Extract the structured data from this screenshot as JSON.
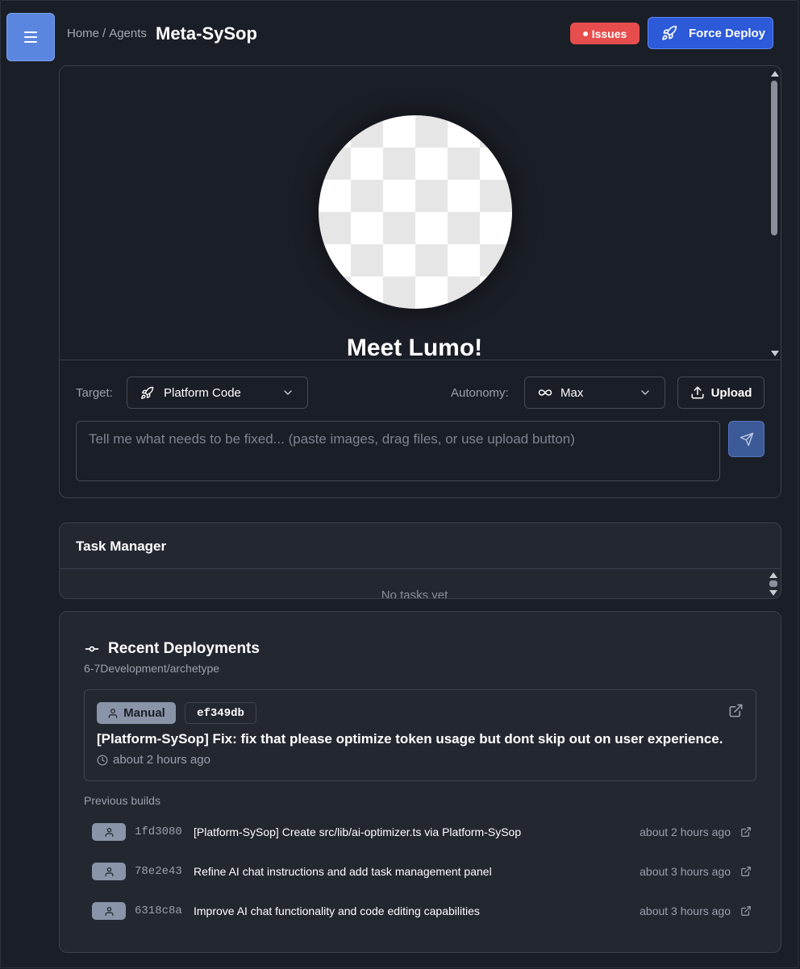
{
  "header": {
    "breadcrumb": [
      "Home",
      "/",
      "Agents"
    ],
    "title": "Meta-SySop",
    "issues_label": "Issues",
    "deploy_label": "Force Deploy"
  },
  "chat": {
    "welcome_title": "Meet Lumo!",
    "target_label": "Target:",
    "target_value": "Platform Code",
    "autonomy_label": "Autonomy:",
    "autonomy_value": "Max",
    "upload_label": "Upload",
    "input_placeholder": "Tell me what needs to be fixed... (paste images, drag files, or use upload button)",
    "input_value": ""
  },
  "tasks": {
    "title": "Task Manager",
    "empty_text": "No tasks yet"
  },
  "deployments": {
    "title": "Recent Deployments",
    "repo": "6-7Development/archetype",
    "latest": {
      "type": "Manual",
      "hash": "ef349db",
      "message": "[Platform-SySop] Fix: fix that please optimize token usage but dont skip out on user experience.",
      "time": "about 2 hours ago"
    },
    "previous_label": "Previous builds",
    "previous": [
      {
        "hash": "1fd3080",
        "message": "[Platform-SySop] Create src/lib/ai-optimizer.ts via Platform-SySop",
        "time": "about 2 hours ago"
      },
      {
        "hash": "78e2e43",
        "message": "Refine AI chat instructions and add task management panel",
        "time": "about 3 hours ago"
      },
      {
        "hash": "6318c8a",
        "message": "Improve AI chat functionality and code editing capabilities",
        "time": "about 3 hours ago"
      }
    ]
  },
  "colors": {
    "background": "#1a1e26",
    "card": "#232730",
    "primary": "#2d5ad8",
    "menu": "#5b86e0",
    "issues": "#e84d4d"
  },
  "icons": [
    "menu-icon",
    "rocket-icon",
    "chevron-down-icon",
    "infinity-icon",
    "upload-icon",
    "send-icon",
    "commit-icon",
    "user-icon",
    "external-link-icon",
    "clock-icon"
  ]
}
